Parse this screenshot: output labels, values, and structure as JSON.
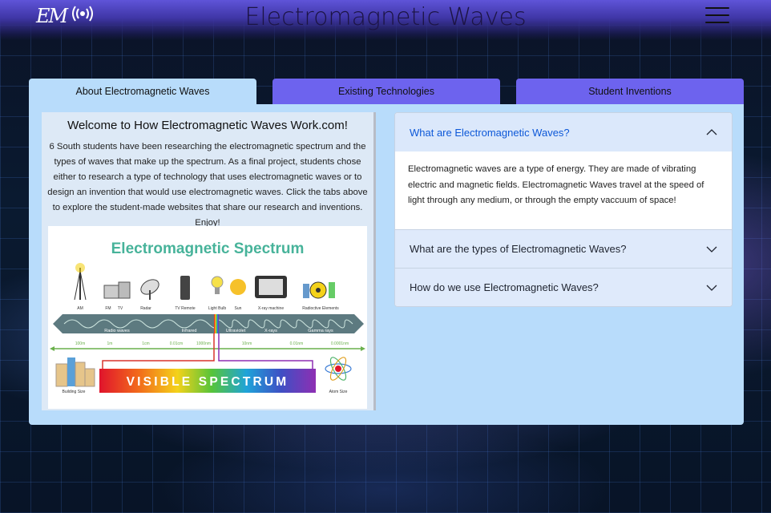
{
  "header": {
    "logo_text": "EM",
    "title": "Electromagnetic Waves",
    "menu_icon": "hamburger-menu-icon"
  },
  "tabs": [
    {
      "label": "About Electromagnetic Waves",
      "active": true
    },
    {
      "label": "Existing Technologies",
      "active": false
    },
    {
      "label": "Student Inventions",
      "active": false
    }
  ],
  "welcome": {
    "heading": "Welcome to How Electromagnetic Waves Work.com!",
    "paragraph": "6 South students have been researching the electromagnetic spectrum and the types of waves that make up the spectrum. As a final project, students chose either to research a type of technology that uses electromagnetic waves or to design an invention that would use electromagnetic waves. Click the tabs above to explore the student-made websites that share our research and inventions. Enjoy!"
  },
  "spectrum_image": {
    "title": "Electromagnetic Spectrum",
    "sources": [
      "AM",
      "FM",
      "TV",
      "Radar",
      "TV Remote",
      "Light Bulb",
      "Sun",
      "X-ray machine",
      "Radioctive Elements"
    ],
    "bands": [
      "Radio waves",
      "Infrared",
      "Ultraviolet",
      "X-rays",
      "Gamma rays"
    ],
    "scale": [
      "100m",
      "1m",
      "1cm",
      "0.01cm",
      "1000nm",
      "10nm",
      "0.01nm",
      "0.0001nm"
    ],
    "visible_label": "VISIBLE SPECTRUM",
    "building_size": "Building Size",
    "atom_size": "Atom Size"
  },
  "accordion": {
    "items": [
      {
        "question": "What are Electromagnetic Waves?",
        "expanded": true,
        "answer": "Electromagnetic waves are a type of energy. They are made of vibrating electric and magnetic fields. Electromagnetic Waves travel at the speed of light through any medium, or through the empty vaccuum of space!"
      },
      {
        "question": "What are the types of Electromagnetic Waves?",
        "expanded": false
      },
      {
        "question": "How do we use Electromagnetic Waves?",
        "expanded": false
      }
    ]
  },
  "colors": {
    "header": "#5f54d8",
    "active_tab": "#b8dcfb",
    "inactive_tab": "#6d63ee",
    "accordion_active_text": "#0d58d8"
  }
}
